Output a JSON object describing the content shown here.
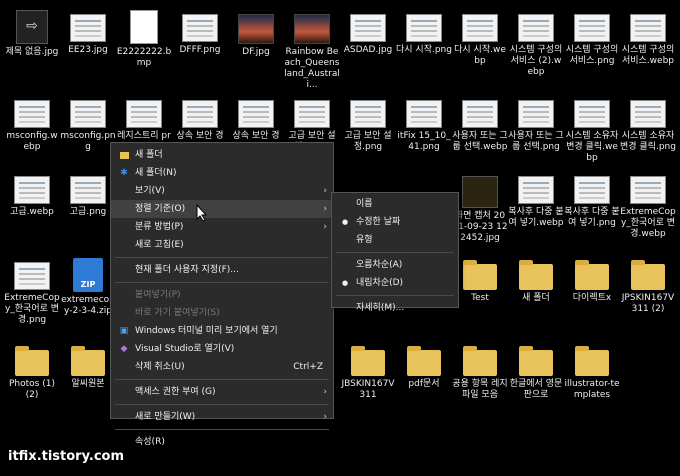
{
  "desktop_icons": [
    {
      "label": "제목 없음.jpg",
      "thumb": "dark"
    },
    {
      "label": "EE23.jpg",
      "thumb": "doc"
    },
    {
      "label": "E2222222.bmp",
      "thumb": "file"
    },
    {
      "label": "DFFF.png",
      "thumb": "doc"
    },
    {
      "label": "DF.jpg",
      "thumb": "photo"
    },
    {
      "label": "Rainbow Beach_Queensland_Australi...",
      "thumb": "photo"
    },
    {
      "label": "ASDAD.jpg",
      "thumb": "doc"
    },
    {
      "label": "다시 시작.png",
      "thumb": "doc"
    },
    {
      "label": "다시 시작.webp",
      "thumb": "doc"
    },
    {
      "label": "시스템 구성의 서비스 (2).webp",
      "thumb": "doc"
    },
    {
      "label": "시스템 구성의 서비스.png",
      "thumb": "doc"
    },
    {
      "label": "시스템 구성의 서비스.webp",
      "thumb": "doc"
    },
    {
      "label": "msconfig.webp",
      "thumb": "doc"
    },
    {
      "label": "msconfig.png",
      "thumb": "doc"
    },
    {
      "label": "레지스트리 provisioni...",
      "thumb": "doc"
    },
    {
      "label": "상속 보안 경고.webp",
      "thumb": "doc"
    },
    {
      "label": "상속 보안 경고.png",
      "thumb": "doc"
    },
    {
      "label": "고급 보안 설정.webp",
      "thumb": "doc"
    },
    {
      "label": "고급 보안 설정.png",
      "thumb": "doc"
    },
    {
      "label": "itFix 15_10_41.png",
      "thumb": "doc"
    },
    {
      "label": "사용자 또는 그룹 선택.webp",
      "thumb": "doc"
    },
    {
      "label": "사용자 또는 그룹 선택.png",
      "thumb": "doc"
    },
    {
      "label": "시스템 소유자 변경 클릭.webp",
      "thumb": "doc"
    },
    {
      "label": "시스템 소유자 변경 클릭.png",
      "thumb": "doc"
    },
    {
      "label": "고급.webp",
      "thumb": "doc"
    },
    {
      "label": "고급.png",
      "thumb": "doc"
    },
    {
      "label": "화면 캡처 2021-09-23 122452.jpg",
      "thumb": "bug"
    },
    {
      "label": "복사후 다중 붙여 넣기.webp",
      "thumb": "doc"
    },
    {
      "label": "복사후 다중 붙여 넣기.png",
      "thumb": "doc"
    },
    {
      "label": "ExtremeCopy_한국어로 변경.webp",
      "thumb": "doc"
    },
    {
      "label": "ExtremeCopy_한국어로 변경.png",
      "thumb": "doc"
    },
    {
      "label": "extremecopy-2-3-4.zip",
      "thumb": "zip"
    },
    {
      "label": "Test",
      "thumb": "folder"
    },
    {
      "label": "새 폴더",
      "thumb": "folder"
    },
    {
      "label": "다이렉트x",
      "thumb": "folder"
    },
    {
      "label": "JPSKIN167V311 (2)",
      "thumb": "folder"
    },
    {
      "label": "Photos (1) (2)",
      "thumb": "folder"
    },
    {
      "label": "알씨원본",
      "thumb": "folder"
    },
    {
      "label": "JBSKIN167V311",
      "thumb": "folder"
    },
    {
      "label": "pdf문서",
      "thumb": "folder"
    },
    {
      "label": "공용 항목 레지파일 모음",
      "thumb": "folder"
    },
    {
      "label": "한글에서 영문판으로",
      "thumb": "folder"
    },
    {
      "label": "illustrator-templates",
      "thumb": "folder"
    }
  ],
  "context_menu": {
    "items": [
      {
        "label": "새 폴더",
        "icon": "folder-icon"
      },
      {
        "label": "새 폴더(N)",
        "icon": "bluetooth-icon"
      },
      {
        "label": "보기(V)",
        "submenu": true
      },
      {
        "label": "정렬 기준(O)",
        "submenu": true,
        "hover": true
      },
      {
        "label": "분류 방법(P)",
        "submenu": true
      },
      {
        "label": "새로 고침(E)"
      },
      {
        "sep": true
      },
      {
        "label": "현재 폴더 사용자 지정(F)..."
      },
      {
        "sep": true
      },
      {
        "label": "붙여넣기(P)",
        "disabled": true
      },
      {
        "label": "바로 가기 붙여넣기(S)",
        "disabled": true
      },
      {
        "label": "Windows 터미널 미리 보기에서 열기",
        "icon": "terminal-icon"
      },
      {
        "label": "Visual Studio로 열기(V)",
        "icon": "visual-studio-icon"
      },
      {
        "label": "삭제 취소(U)",
        "shortcut": "Ctrl+Z"
      },
      {
        "sep": true
      },
      {
        "label": "액세스 권한 부여 (G)",
        "submenu": true
      },
      {
        "sep": true
      },
      {
        "label": "새로 만들기(W)",
        "submenu": true
      },
      {
        "sep": true
      },
      {
        "label": "속성(R)"
      }
    ]
  },
  "sort_submenu": {
    "items": [
      {
        "label": "이름"
      },
      {
        "label": "수정한 날짜",
        "selected": true
      },
      {
        "label": "유형"
      },
      {
        "sep": true
      },
      {
        "label": "오름차순(A)"
      },
      {
        "label": "내림차순(D)",
        "selected": true
      },
      {
        "sep": true
      },
      {
        "label": "자세히(M)..."
      }
    ]
  },
  "watermark": "itfix.tistory.com"
}
